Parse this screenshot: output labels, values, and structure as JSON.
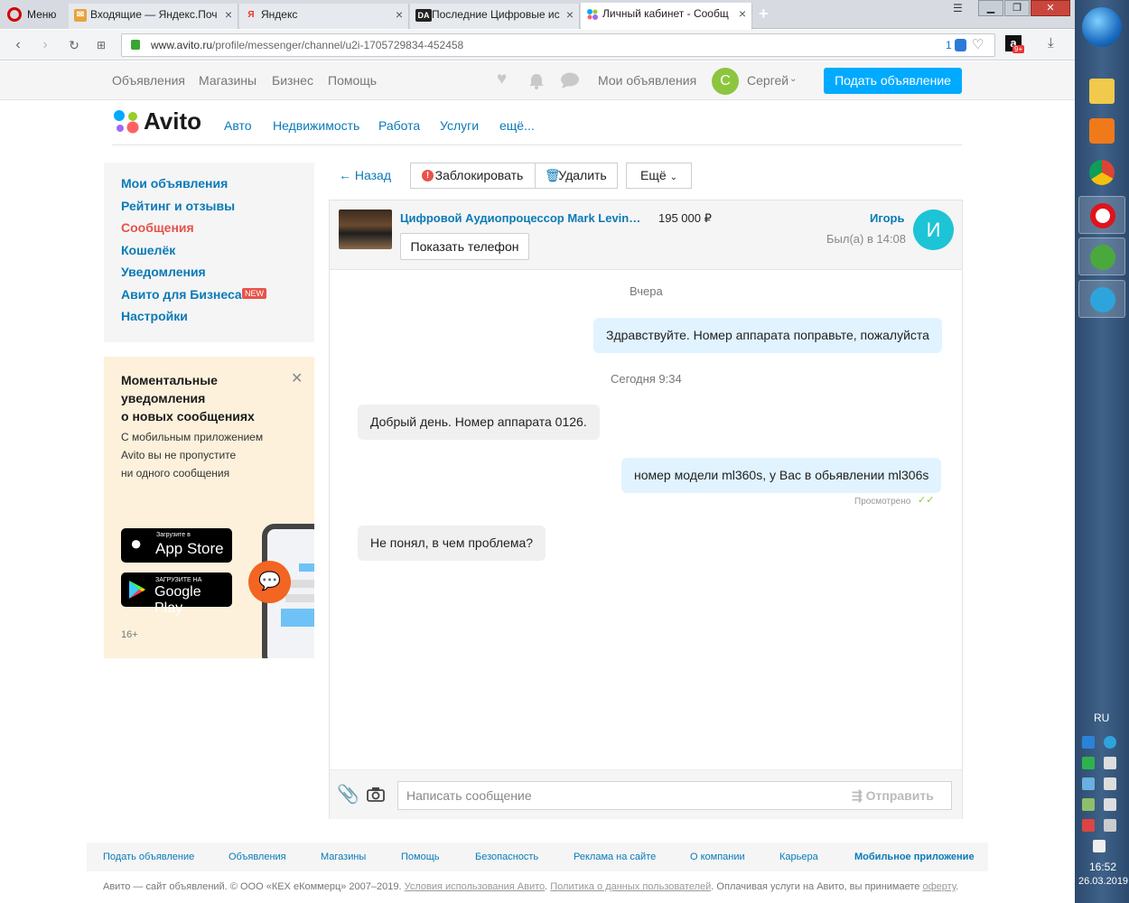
{
  "browser": {
    "menu_label": "Меню",
    "tabs": [
      {
        "title": "Входящие — Яндекс.Поч",
        "icon": "mail-icon"
      },
      {
        "title": "Яндекс",
        "icon": "yandex-icon"
      },
      {
        "title": "Последние Цифровые ис",
        "icon": "da-icon",
        "icon_text": "DA"
      },
      {
        "title": "Личный кабинет - Сообщ",
        "icon": "avito-icon",
        "active": true
      }
    ],
    "url_host": "www.avito.ru",
    "url_path": "/profile/messenger/channel/u2i-1705729834-452458",
    "vpn_badge": "1",
    "ext_badge": "9+"
  },
  "site_top": {
    "links": [
      "Объявления",
      "Магазины",
      "Бизнес",
      "Помощь"
    ],
    "my_ads": "Мои объявления",
    "avatar_letter": "С",
    "user_name": "Сергей",
    "post_button": "Подать объявление"
  },
  "logo_text": "Avito",
  "categories": [
    "Авто",
    "Недвижимость",
    "Работа",
    "Услуги",
    "ещё..."
  ],
  "sidebar": {
    "items": [
      {
        "label": "Мои объявления"
      },
      {
        "label": "Рейтинг и отзывы"
      },
      {
        "label": "Сообщения",
        "active": true
      },
      {
        "label": "Кошелёк"
      },
      {
        "label": "Уведомления"
      },
      {
        "label": "Авито для Бизнеса",
        "badge": "NEW"
      },
      {
        "label": "Настройки"
      }
    ]
  },
  "promo": {
    "title": [
      "Моментальные",
      "уведомления",
      "о новых сообщениях"
    ],
    "text": [
      "С мобильным приложением",
      "Avito вы не пропустите",
      "ни одного сообщения"
    ],
    "appstore_small": "Загрузите в",
    "appstore_big": "App Store",
    "gplay_small": "ЗАГРУЗИТЕ НА",
    "gplay_big": "Google Play",
    "age": "16+"
  },
  "chat_toolbar": {
    "back": "← Назад",
    "block": "Заблокировать",
    "delete": "Удалить",
    "more": "Ещё"
  },
  "chat": {
    "item_title": "Цифровой Аудиопроцессор Mark Levin…",
    "price": "195 000 ₽",
    "show_phone": "Показать телефон",
    "partner_name": "Игорь",
    "partner_status": "Был(а) в 14:08",
    "partner_letter": "И",
    "separators": [
      "Вчера",
      "Сегодня 9:34"
    ],
    "messages": [
      {
        "dir": "out",
        "text": "Здравствуйте. Номер аппарата поправьте, пожалуйста"
      },
      {
        "dir": "in",
        "text": "Добрый день. Номер аппарата 0126."
      },
      {
        "dir": "out",
        "text": "номер модели ml360s, у Вас в обьявлении ml306s"
      },
      {
        "dir": "in",
        "text": "Не понял, в чем проблема?"
      }
    ],
    "seen_label": "Просмотрено",
    "input_placeholder": "Написать сообщение",
    "send_label": "Отправить"
  },
  "footer": {
    "links": [
      "Подать объявление",
      "Объявления",
      "Магазины",
      "Помощь",
      "Безопасность",
      "Реклама на сайте",
      "О компании",
      "Карьера",
      "Мобильное приложение"
    ],
    "copy_text": "Авито — сайт объявлений. © ООО «КЕХ еКоммерц» 2007–2019.",
    "terms": "Условия использования Авито",
    "privacy": "Политика о данных пользователей",
    "paid_text": ". Оплачивая услуги на Авито, вы принимаете",
    "offer": "оферту"
  },
  "taskbar": {
    "lang": "RU",
    "time": "16:52",
    "date": "26.03.2019"
  },
  "colors": {
    "accent": "#00aaff",
    "link": "#0a7ab8",
    "active_nav": "#e8524a",
    "outgoing_bubble": "#e0f3ff",
    "incoming_bubble": "#f0f0f0"
  }
}
